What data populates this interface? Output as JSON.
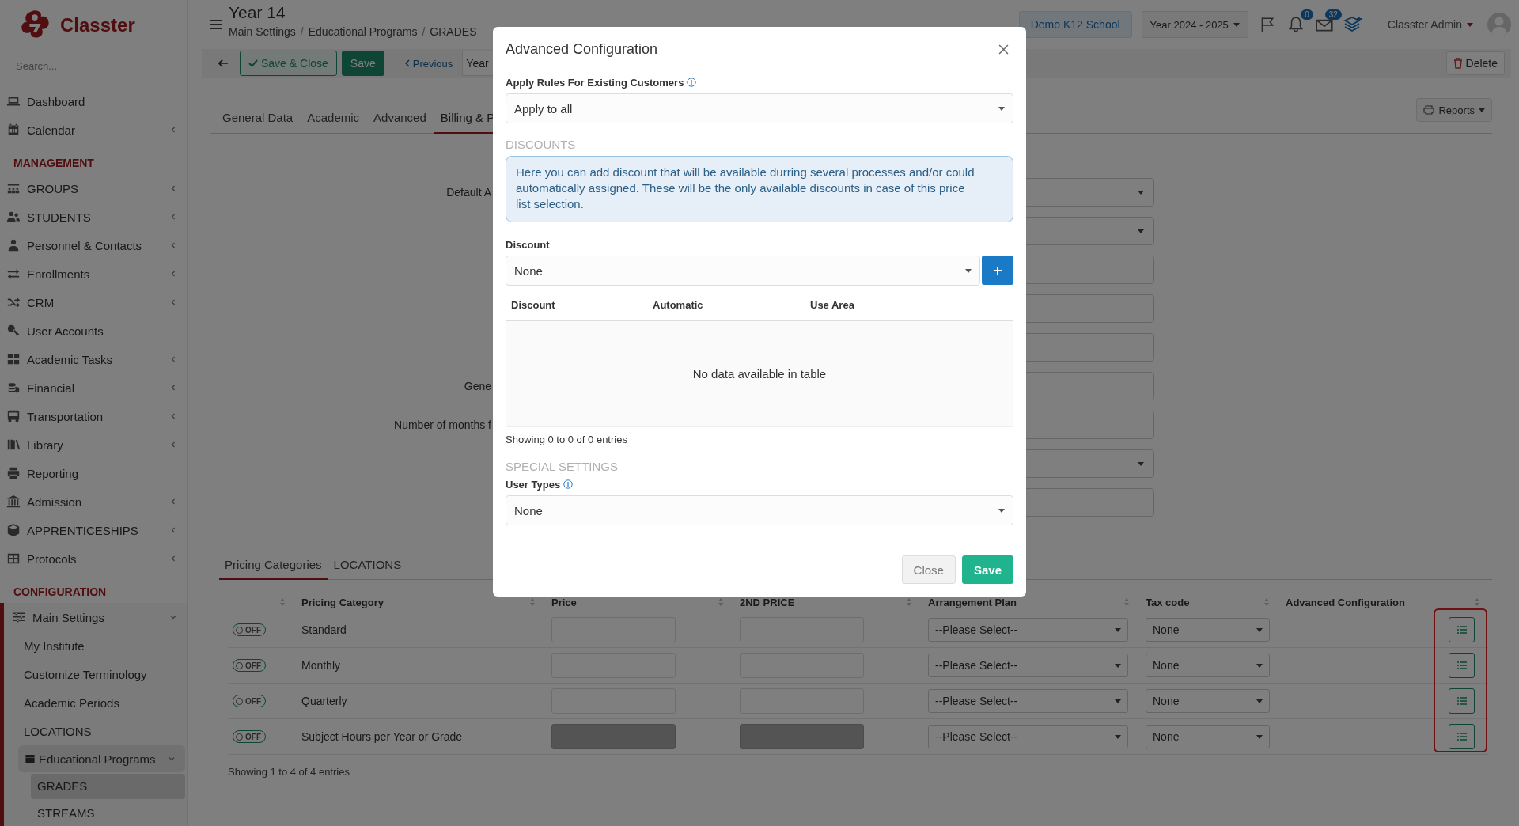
{
  "sidebar": {
    "logo_text": "Classter",
    "search": {
      "placeholder": "Search..."
    },
    "sections": [
      {
        "items": [
          {
            "label": "Dashboard",
            "selected": false
          },
          {
            "label": "Calendar",
            "expanded": false,
            "selected": false
          }
        ]
      },
      {
        "heading": "MANAGEMENT",
        "items": [
          {
            "label": "GROUPS",
            "expanded": false,
            "selected": false
          },
          {
            "label": "STUDENTS",
            "expanded": false,
            "selected": false
          },
          {
            "label": "Personnel & Contacts",
            "expanded": false,
            "selected": false
          },
          {
            "label": "Enrollments",
            "expanded": false,
            "selected": false
          },
          {
            "label": "CRM",
            "expanded": false,
            "selected": false
          },
          {
            "label": "User Accounts",
            "selected": false
          },
          {
            "label": "Academic Tasks",
            "expanded": false,
            "selected": false
          },
          {
            "label": "Financial",
            "expanded": false,
            "selected": false
          },
          {
            "label": "Transportation",
            "expanded": false,
            "selected": false
          },
          {
            "label": "Library",
            "expanded": false,
            "selected": false
          },
          {
            "label": "Reporting",
            "selected": false
          },
          {
            "label": "Admission",
            "expanded": false,
            "selected": false
          },
          {
            "label": "APPRENTICESHIPS",
            "expanded": false,
            "selected": false
          },
          {
            "label": "Protocols",
            "expanded": false,
            "selected": false
          }
        ]
      },
      {
        "heading": "CONFIGURATION",
        "items": [
          {
            "label": "Main Settings",
            "expanded": true,
            "selected": false,
            "children": [
              {
                "label": "My Institute",
                "selected": false
              },
              {
                "label": "Customize Terminology",
                "selected": false
              },
              {
                "label": "Academic Periods",
                "selected": false
              },
              {
                "label": "LOCATIONS",
                "selected": false
              },
              {
                "label": "Educational Programs",
                "expanded": true,
                "selected": false,
                "children": [
                  {
                    "label": "GRADES",
                    "selected": true
                  },
                  {
                    "label": "STREAMS",
                    "selected": false
                  }
                ]
              }
            ]
          }
        ]
      }
    ]
  },
  "header": {
    "title": "Year 14",
    "breadcrumbs": [
      "Main Settings",
      "Educational Programs",
      "GRADES"
    ],
    "breadcrumb_separator": "/",
    "school": "Demo K12 School",
    "year": "Year 2024 - 2025",
    "notifications": "0",
    "messages": "32",
    "user": "Classter Admin"
  },
  "toolbar": {
    "buttons": [
      {
        "label": "Save & Close",
        "kind": "outline"
      },
      {
        "label": "Save",
        "kind": "solid"
      }
    ],
    "previous": "Previous",
    "record": "Year",
    "delete": "Delete"
  },
  "tabs": [
    {
      "label": "General Data",
      "selected": false
    },
    {
      "label": "Academic",
      "selected": false
    },
    {
      "label": "Advanced",
      "selected": false
    },
    {
      "label": "Billing & P",
      "selected": true
    }
  ],
  "reports": "Reports",
  "form": {
    "rows": [
      {
        "label": "Default A",
        "kind": "select"
      },
      {
        "kind": "select"
      },
      {
        "kind": "input"
      },
      {
        "kind": "input"
      },
      {
        "kind": "input"
      },
      {
        "label": "Gene",
        "kind": "input"
      },
      {
        "label": "Number of months f",
        "kind": "input"
      },
      {
        "kind": "select"
      },
      {
        "kind": "input"
      }
    ]
  },
  "pricing": {
    "tabs": [
      {
        "label": "Pricing Categories",
        "selected": true
      },
      {
        "label": "LOCATIONS",
        "selected": false
      }
    ],
    "columns": [
      "Pricing Category",
      "Price",
      "2ND PRICE",
      "Arrangement Plan",
      "Tax code",
      "Advanced Configuration"
    ],
    "rows": [
      {
        "toggle": "OFF",
        "on": false,
        "name": "Standard",
        "disabled": false,
        "plan": "--Please Select--",
        "tax": "None"
      },
      {
        "toggle": "OFF",
        "on": false,
        "name": "Monthly",
        "disabled": false,
        "plan": "--Please Select--",
        "tax": "None"
      },
      {
        "toggle": "OFF",
        "on": false,
        "name": "Quarterly",
        "disabled": false,
        "plan": "--Please Select--",
        "tax": "None"
      },
      {
        "toggle": "OFF",
        "on": false,
        "name": "Subject Hours per Year or Grade",
        "disabled": true,
        "plan": "--Please Select--",
        "tax": "None"
      }
    ],
    "footer": "Showing 1 to 4 of 4 entries",
    "config_highlighted": true
  },
  "modal": {
    "title": "Advanced Configuration",
    "apply_rules": {
      "label": "Apply Rules For Existing Customers",
      "value": "Apply to all"
    },
    "discounts_heading": "DISCOUNTS",
    "info": "Here you can add discount that will be available durring several processes and/or could automatically assigned. These will be the only available discounts in case of this price list selection.",
    "discount": {
      "label": "Discount",
      "value": "None"
    },
    "table": {
      "columns": [
        "Discount",
        "Automatic",
        "Use Area"
      ],
      "empty": "No data available in table",
      "footer": "Showing 0 to 0 of 0 entries"
    },
    "special_heading": "SPECIAL SETTINGS",
    "user_types": {
      "label": "User Types",
      "value": "None"
    },
    "buttons": [
      {
        "label": "Close",
        "kind": "secondary"
      },
      {
        "label": "Save",
        "kind": "primary"
      }
    ]
  }
}
